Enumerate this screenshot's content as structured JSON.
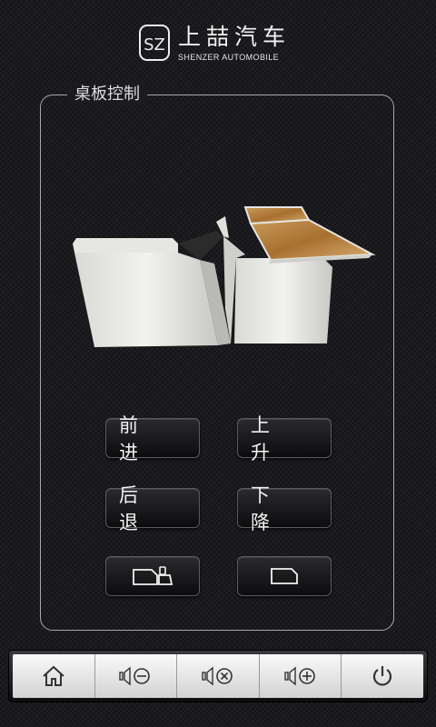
{
  "brand": {
    "name_cn": "上喆汽车",
    "name_en": "SHENZER AUTOMOBILE",
    "logo_mark": "SZ"
  },
  "panel": {
    "title": "桌板控制"
  },
  "controls": {
    "forward": "前 进",
    "up": "上 升",
    "backward": "后 退",
    "down": "下 降",
    "tray_extend_icon": "tray-extend-icon",
    "tray_retract_icon": "tray-retract-icon"
  },
  "toolbar": {
    "items": [
      {
        "icon": "home-icon"
      },
      {
        "icon": "volume-down-icon"
      },
      {
        "icon": "mute-icon"
      },
      {
        "icon": "volume-up-icon"
      },
      {
        "icon": "power-icon"
      }
    ]
  },
  "colors": {
    "background": "#1b1b1f",
    "panel_border": "#a7a7ac",
    "button_text": "#f2f2f2",
    "toolbar_bg": "#e8e8e8",
    "wood": "#b07a3a"
  }
}
